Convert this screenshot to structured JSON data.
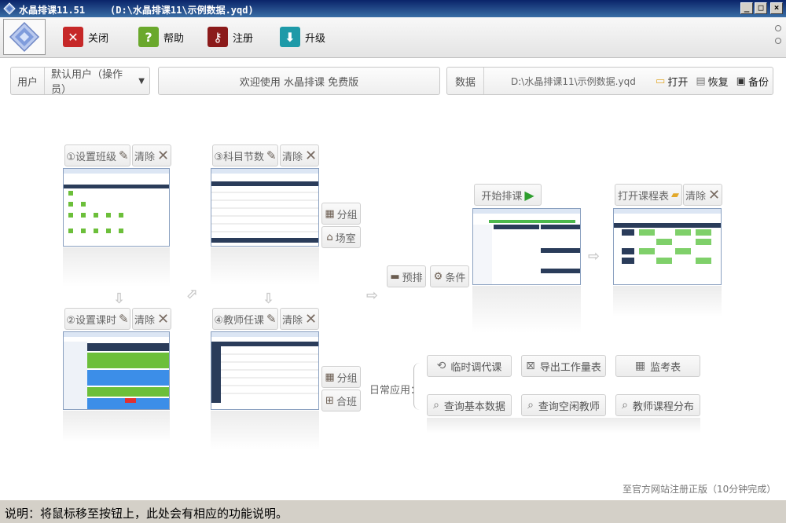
{
  "window": {
    "title": "水晶排课11.51",
    "path": "(D:\\水晶排课11\\示例数据.yqd)"
  },
  "toolbar": {
    "close_label": "关闭",
    "help_label": "帮助",
    "register_label": "注册",
    "upgrade_label": "升级"
  },
  "user": {
    "label": "用户",
    "value": "默认用户（操作员）"
  },
  "welcome": "欢迎使用 水晶排课 免费版",
  "data_box": {
    "label": "数据",
    "path": "D:\\水晶排课11\\示例数据.yqd",
    "open": "打开",
    "restore": "恢复",
    "backup": "备份"
  },
  "workflow": {
    "step1": "①设置班级",
    "step2": "②设置课时",
    "step3": "③科目节数",
    "step4": "④教师任课",
    "clear": "清除",
    "group": "分组",
    "venue": "场室",
    "combine": "合班",
    "prearrange": "预排",
    "condition": "条件",
    "start": "开始排课",
    "open_schedule": "打开课程表"
  },
  "daily": {
    "label": "日常应用：",
    "buttons": [
      "临时调代课",
      "导出工作量表",
      "监考表",
      "查询基本数据",
      "查询空闲教师",
      "教师课程分布"
    ]
  },
  "register_link": "至官方网站注册正版（10分钟完成）",
  "status": "说明：将鼠标移至按钮上，此处会有相应的功能说明。",
  "colors": {
    "titlebar": "#0a246a",
    "close_icon": "#c62828",
    "help_icon": "#6aa82c",
    "register_icon": "#8b1a1a",
    "upgrade_icon": "#1e9aa8",
    "start_arrow": "#2e9e2e"
  },
  "icons": {
    "close": "close-icon",
    "help": "help-icon",
    "register": "key-icon",
    "upgrade": "download-icon"
  }
}
